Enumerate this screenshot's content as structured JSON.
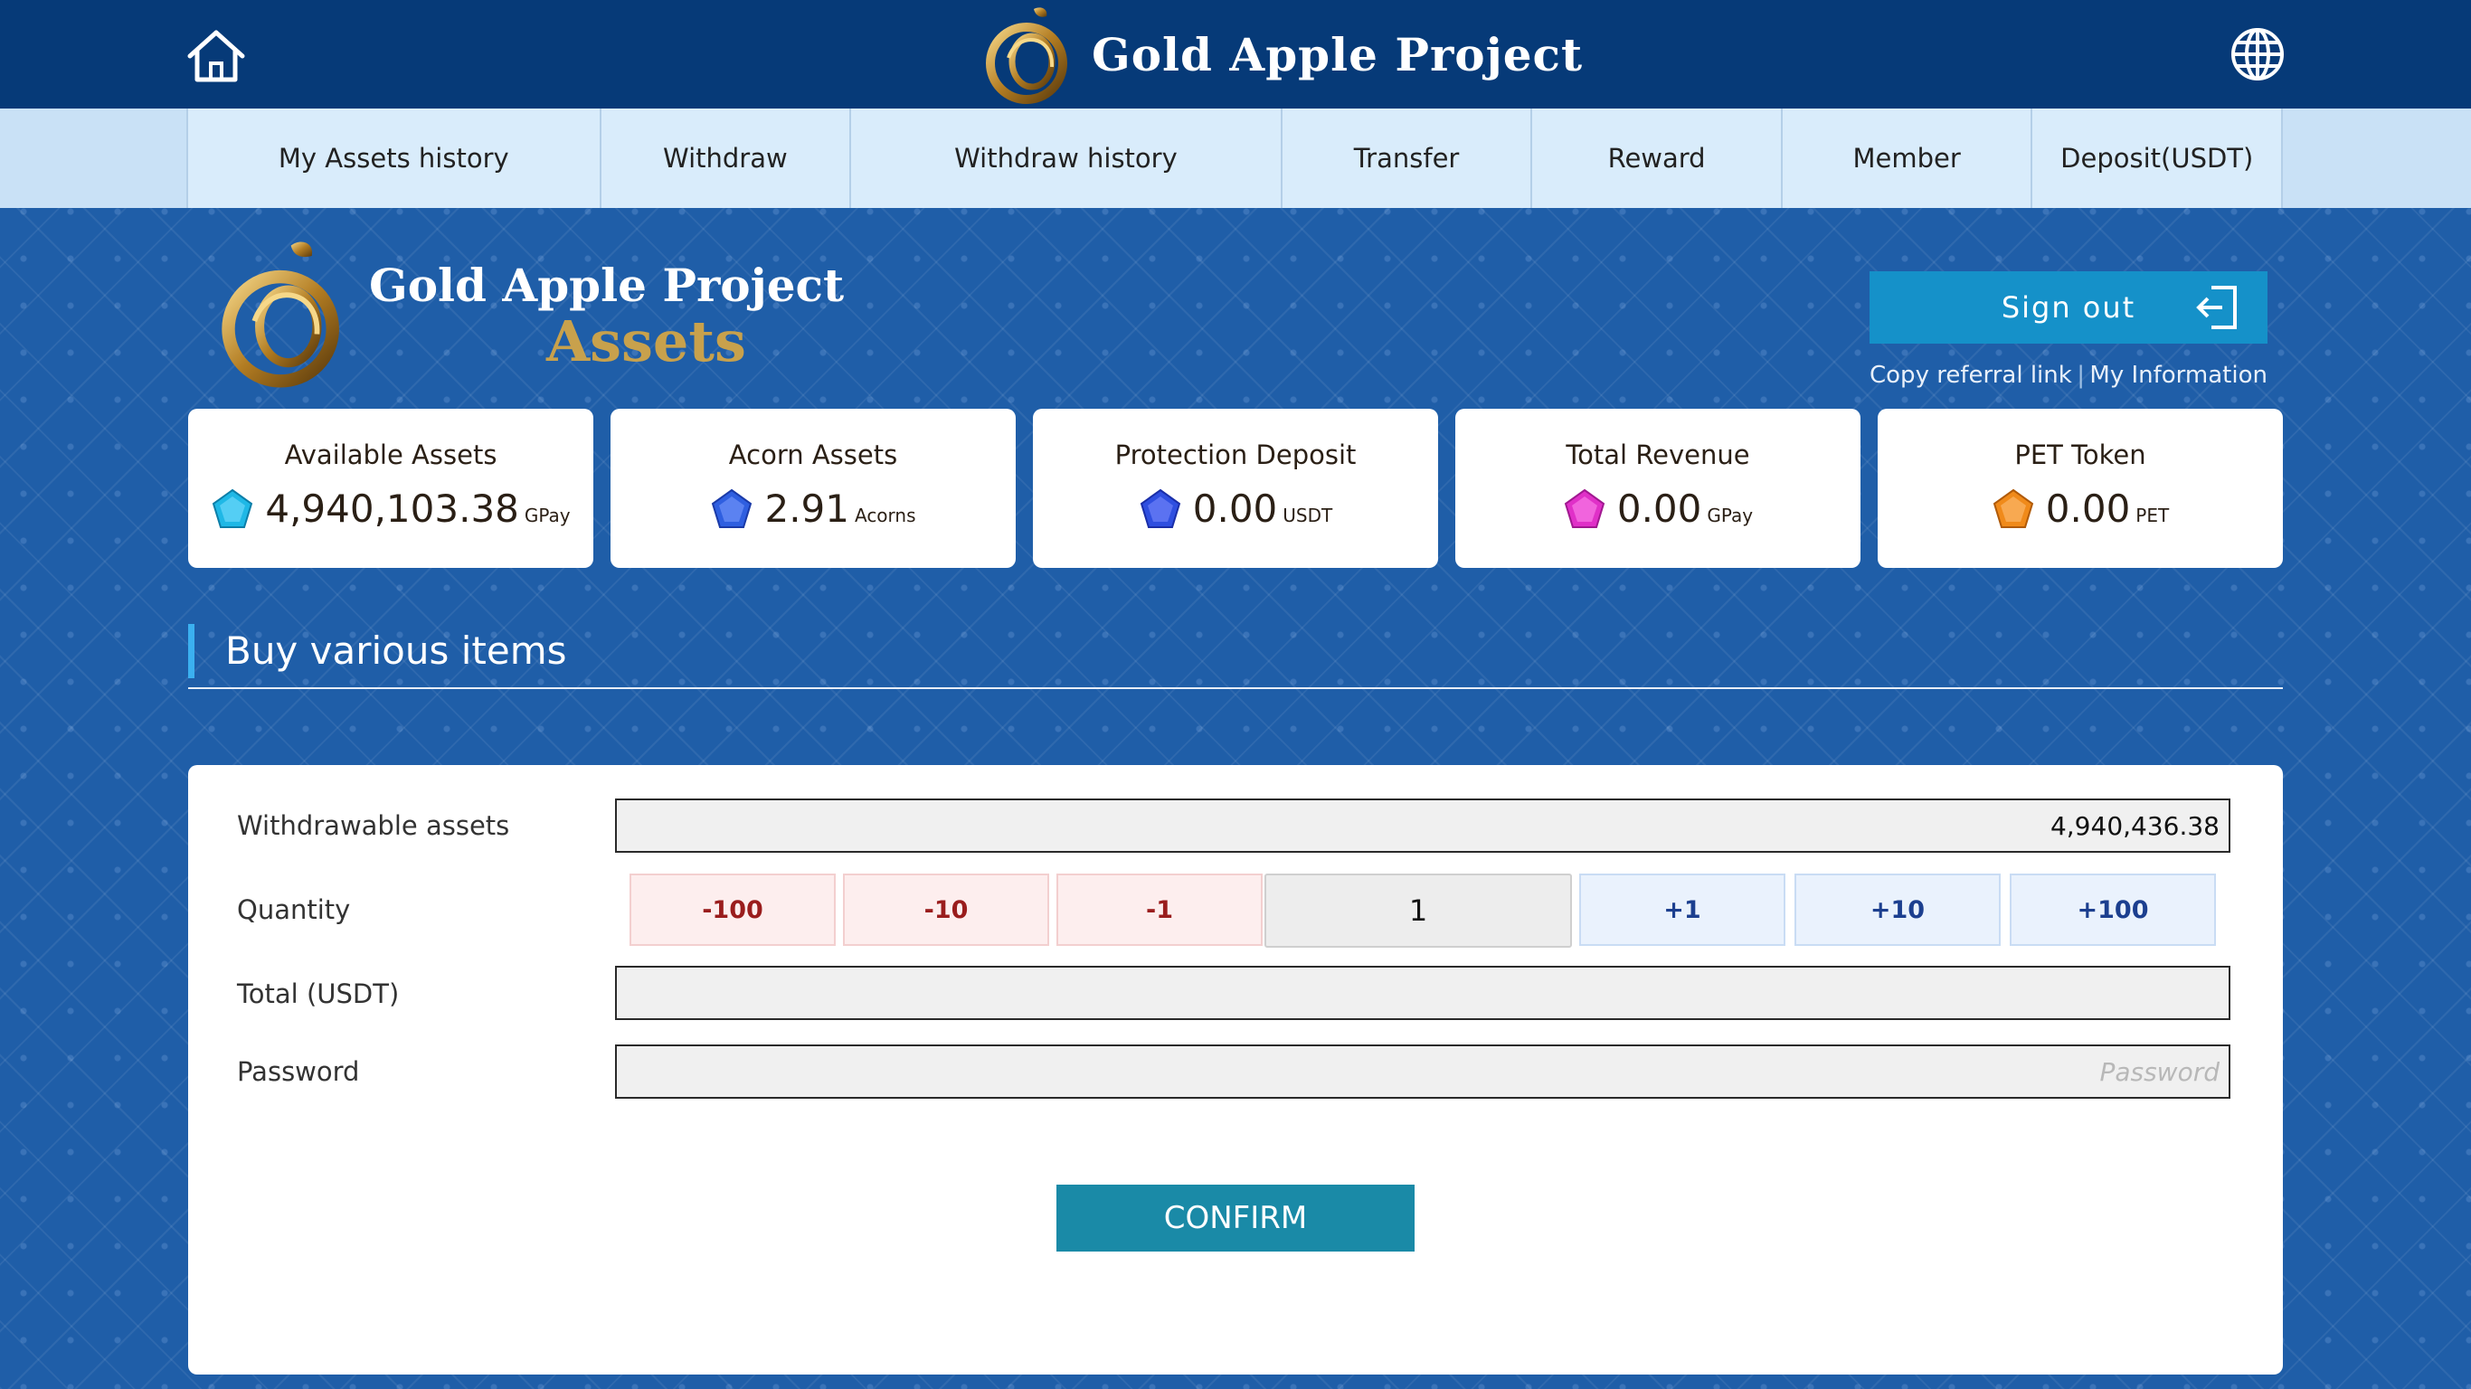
{
  "header": {
    "brand_title": "Gold Apple Project",
    "home_icon": "home-icon",
    "language_icon": "globe-icon"
  },
  "nav": {
    "items": [
      {
        "label": "My Assets history"
      },
      {
        "label": "Withdraw"
      },
      {
        "label": "Withdraw history"
      },
      {
        "label": "Transfer"
      },
      {
        "label": "Reward"
      },
      {
        "label": "Member"
      },
      {
        "label": "Deposit(USDT)"
      }
    ]
  },
  "hero": {
    "logo_title": "Gold Apple Project",
    "logo_subtitle": "Assets",
    "signout_label": "Sign out",
    "copy_referral_label": "Copy referral link",
    "separator": "|",
    "my_information_label": "My Information"
  },
  "cards": [
    {
      "title": "Available Assets",
      "value": "4,940,103.38",
      "unit": "GPay",
      "gem_color": "#1fb8e6"
    },
    {
      "title": "Acorn Assets",
      "value": "2.91",
      "unit": "Acorns",
      "gem_color": "#2f5fe0"
    },
    {
      "title": "Protection Deposit",
      "value": "0.00",
      "unit": "USDT",
      "gem_color": "#2f4fe0"
    },
    {
      "title": "Total Revenue",
      "value": "0.00",
      "unit": "GPay",
      "gem_color": "#e030c8"
    },
    {
      "title": "PET Token",
      "value": "0.00",
      "unit": "PET",
      "gem_color": "#f08a1a"
    }
  ],
  "section": {
    "title": "Buy various items"
  },
  "form": {
    "withdrawable_label": "Withdrawable assets",
    "withdrawable_value": "4,940,436.38",
    "quantity_label": "Quantity",
    "minus_buttons": [
      "-100",
      "-10",
      "-1"
    ],
    "quantity_value": "1",
    "plus_buttons": [
      "+1",
      "+10",
      "+100"
    ],
    "total_label": "Total (USDT)",
    "total_value": "",
    "password_label": "Password",
    "password_placeholder": "Password",
    "confirm_label": "CONFIRM"
  },
  "colors": {
    "topbar": "#063a78",
    "background": "#1f5ea8",
    "signout": "#1591c9",
    "confirm": "#1a8aa7",
    "accent_gold": "#c8a14c"
  }
}
